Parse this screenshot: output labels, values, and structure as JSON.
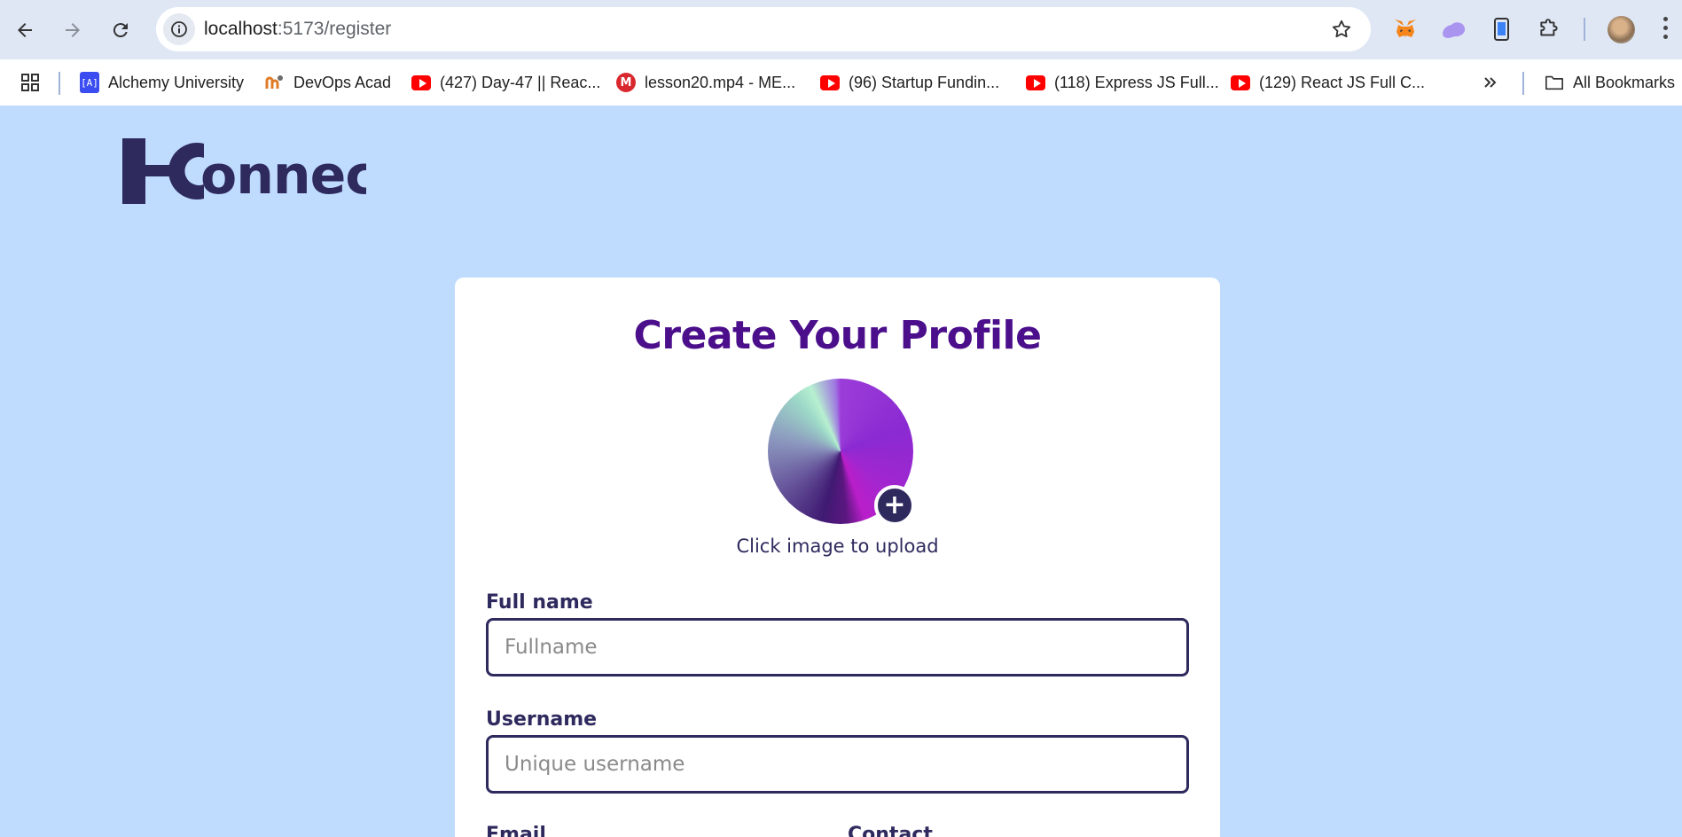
{
  "browser": {
    "url_host": "localhost",
    "url_path": ":5173/register",
    "nav": {
      "back_icon": "arrow-left",
      "forward_icon": "arrow-right",
      "reload_icon": "reload"
    },
    "extensions": [
      "metamask-fox-icon",
      "purple-cloud-icon",
      "phone-extension-icon",
      "puzzle-extensions-icon"
    ],
    "bookmarks": [
      {
        "label": "Alchemy University",
        "icon": "alchemy-icon"
      },
      {
        "label": "DevOps Acad",
        "icon": "devops-icon"
      },
      {
        "label": "(427) Day-47 || Reac...",
        "icon": "youtube-icon"
      },
      {
        "label": "lesson20.mp4 - ME...",
        "icon": "mega-icon"
      },
      {
        "label": "(96) Startup Fundin...",
        "icon": "youtube-icon"
      },
      {
        "label": "(118) Express JS Full...",
        "icon": "youtube-icon"
      },
      {
        "label": "(129) React JS Full C...",
        "icon": "youtube-icon"
      }
    ],
    "all_bookmarks_label": "All Bookmarks"
  },
  "page": {
    "logo_text": "Konnect",
    "brand_color": "#2e2a5e",
    "title": "Create Your Profile",
    "title_color": "#4c0f8c",
    "upload_hint": "Click image to upload",
    "fields": {
      "fullname": {
        "label": "Full name",
        "placeholder": "Fullname",
        "value": ""
      },
      "username": {
        "label": "Username",
        "placeholder": "Unique username",
        "value": ""
      },
      "email": {
        "label": "Email"
      },
      "contact": {
        "label": "Contact"
      }
    }
  }
}
